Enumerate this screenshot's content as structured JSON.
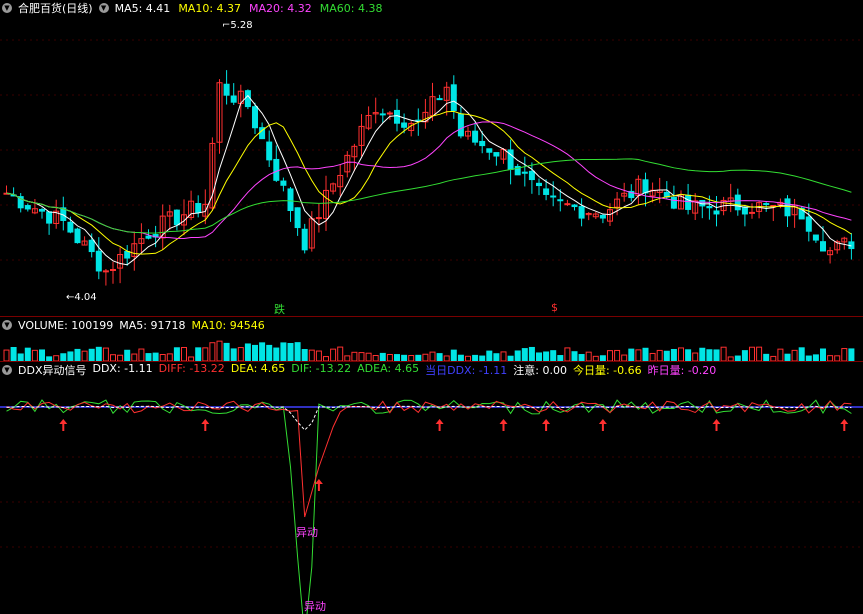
{
  "price_panel": {
    "stock_title": "合肥百货(日线)",
    "ma_labels": [
      {
        "text": "MA5: 4.41",
        "color": "#ffffff"
      },
      {
        "text": "MA10: 4.37",
        "color": "#ffff00"
      },
      {
        "text": "MA20: 4.32",
        "color": "#ff44ff"
      },
      {
        "text": "MA60: 4.38",
        "color": "#33dd33"
      }
    ],
    "high_label": "5.28",
    "low_label": "4.04",
    "signal_down": "跌",
    "signal_dollar": "$",
    "ylim": [
      3.95,
      5.4
    ]
  },
  "volume_panel": {
    "labels": [
      {
        "text": "VOLUME: 100199",
        "color": "#ffffff"
      },
      {
        "text": "MA5: 91718",
        "color": "#ffffff"
      },
      {
        "text": "MA10: 94546",
        "color": "#ffff00"
      }
    ]
  },
  "ddx_panel": {
    "labels": [
      {
        "text": "DDX异动信号",
        "color": "#ffffff"
      },
      {
        "text": "DDX: -1.11",
        "color": "#ffffff"
      },
      {
        "text": "DIFF: -13.22",
        "color": "#ff3030"
      },
      {
        "text": "DEA: 4.65",
        "color": "#ffff00"
      },
      {
        "text": "DIF: -13.22",
        "color": "#33dd33"
      },
      {
        "text": "ADEA: 4.65",
        "color": "#33dd33"
      },
      {
        "text": "当日DDX: -1.11",
        "color": "#4040ff"
      },
      {
        "text": "注意: 0.00",
        "color": "#ffffff"
      },
      {
        "text": "今日量: -0.66",
        "color": "#ffff00"
      },
      {
        "text": "昨日量: -0.20",
        "color": "#ff44ff"
      }
    ],
    "signal_1": "异动",
    "signal_2": "异动"
  },
  "colors": {
    "up": "#ff3030",
    "down": "#00e5e5",
    "bg": "#000000",
    "sep": "#7a0000"
  }
}
